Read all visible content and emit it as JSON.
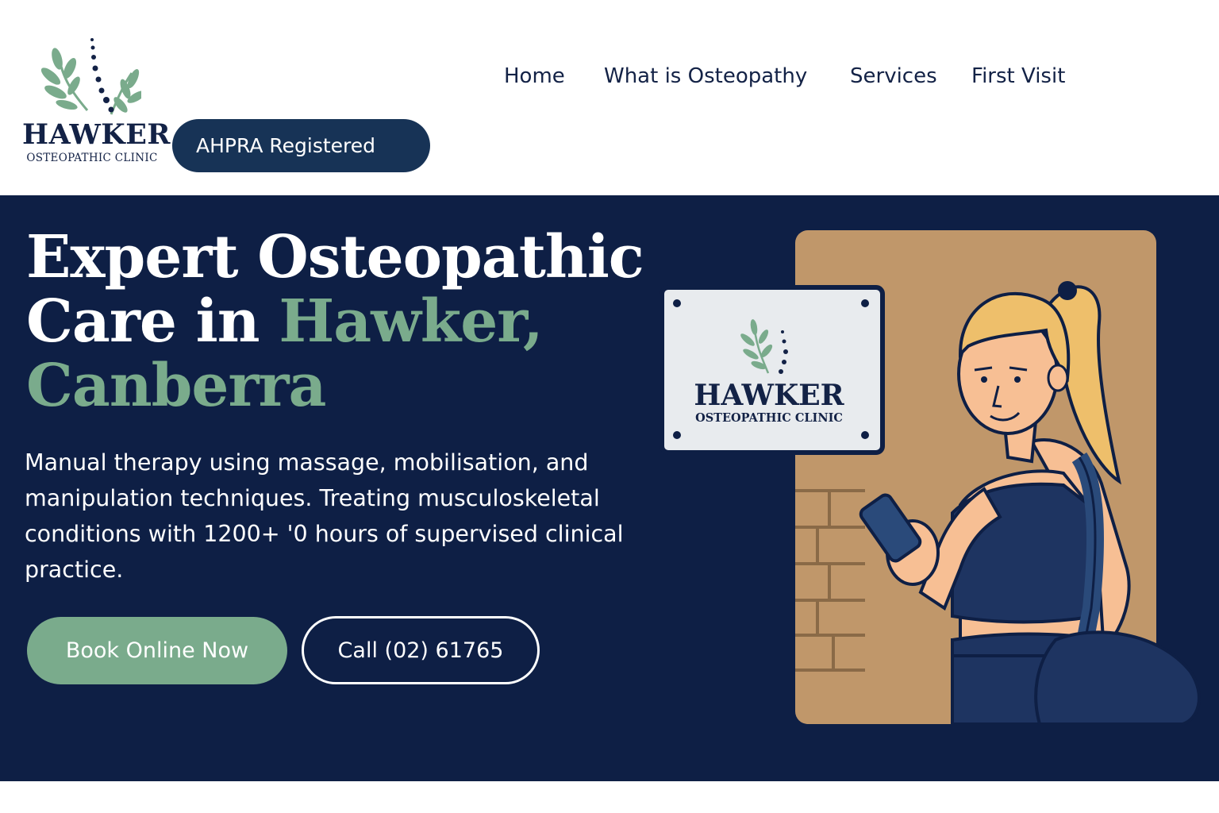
{
  "header": {
    "logo": {
      "title": "HAWKER",
      "subtitle": "OSTEOPATHIC CLINIC"
    },
    "badge": "AHPRA Registered",
    "nav": [
      "Home",
      "What is Osteopathy",
      "Services",
      "First Visit"
    ]
  },
  "hero": {
    "headline_line1": "Expert Osteopathic",
    "headline_line2_plain": "Care in ",
    "headline_line2_accent": "Hawker,",
    "headline_line3_accent": "Canberra",
    "description": "Manual therapy using massage, mobilisation, and manipulation techniques. Treating musculoskeletal conditions with 1200+ '0 hours of supervised clinical practice.",
    "book_button": "Book Online Now",
    "call_button": "Call (02) 61765",
    "plaque": {
      "title": "HAWKER",
      "subtitle": "OSTEOPATHIC CLINIC"
    }
  },
  "colors": {
    "navy": "#0e1f45",
    "dark_navy_text": "#132246",
    "badge_blue": "#173356",
    "sage_green": "#7aab8c",
    "tan_wall": "#c0976a",
    "white": "#ffffff"
  },
  "icons": [
    "leaf-spine-logo-icon",
    "leaf-spine-plaque-icon"
  ]
}
